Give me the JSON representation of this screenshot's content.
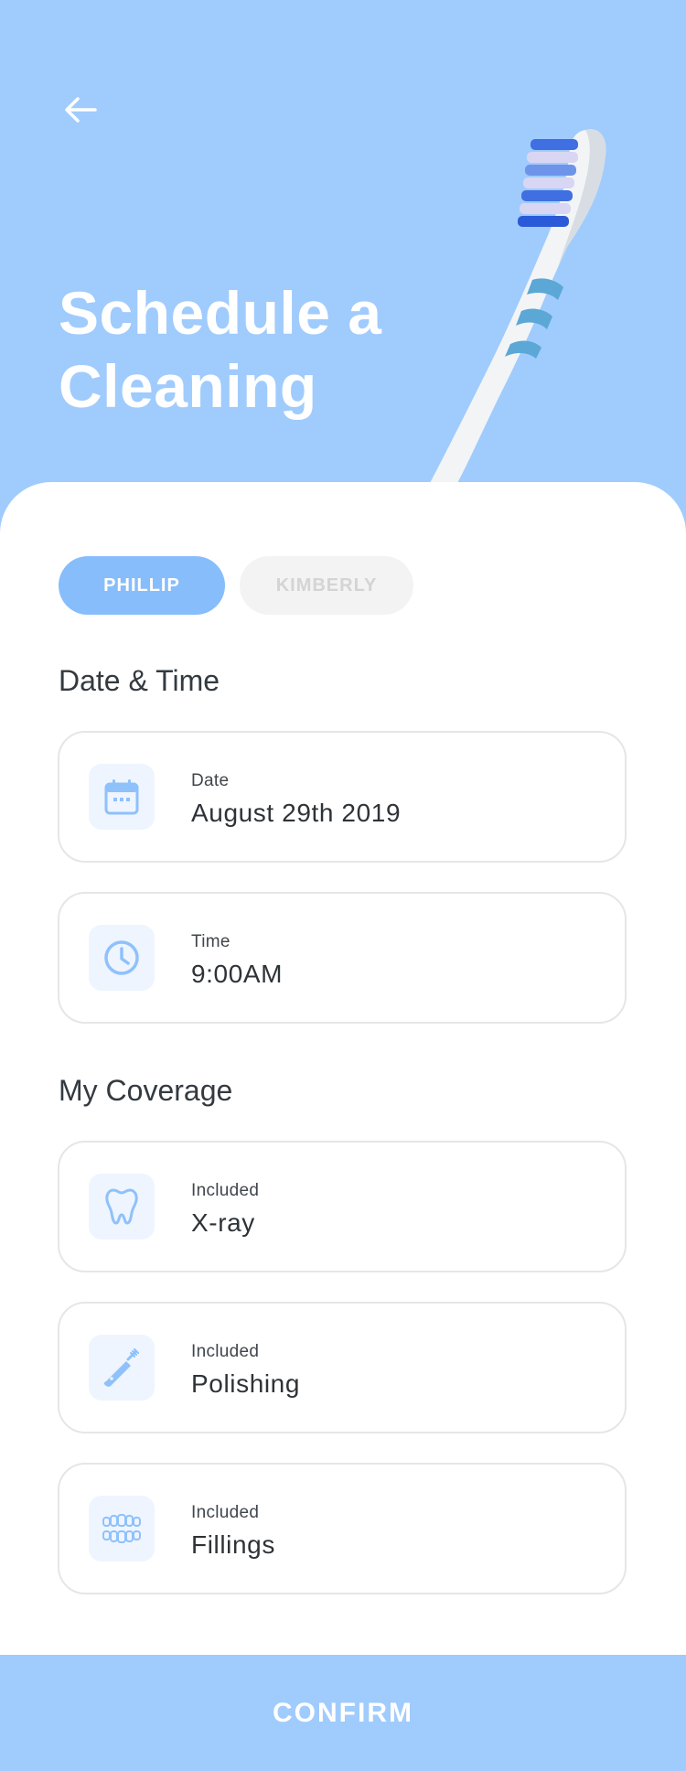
{
  "header": {
    "back_icon": "arrow-left-icon",
    "title": "Schedule a Cleaning",
    "illustration": "toothbrush"
  },
  "patients": {
    "items": [
      {
        "label": "PHILLIP",
        "active": true
      },
      {
        "label": "KIMBERLY",
        "active": false
      }
    ]
  },
  "date_time": {
    "section_title": "Date & Time",
    "date": {
      "label": "Date",
      "value": "August 29th 2019",
      "icon": "calendar-icon"
    },
    "time": {
      "label": "Time",
      "value": "9:00AM",
      "icon": "clock-icon"
    }
  },
  "coverage": {
    "section_title": "My Coverage",
    "items": [
      {
        "label": "Included",
        "value": "X-ray",
        "icon": "tooth-icon"
      },
      {
        "label": "Included",
        "value": "Polishing",
        "icon": "electric-toothbrush-icon"
      },
      {
        "label": "Included",
        "value": "Fillings",
        "icon": "teeth-icon"
      }
    ]
  },
  "footer": {
    "confirm_label": "CONFIRM"
  },
  "colors": {
    "primary": "#a0cbfd",
    "chip_active": "#87bdfb",
    "icon_accent": "#8fc1fb",
    "icon_bg": "#eef5ff",
    "card_border": "#e6e6e6"
  }
}
